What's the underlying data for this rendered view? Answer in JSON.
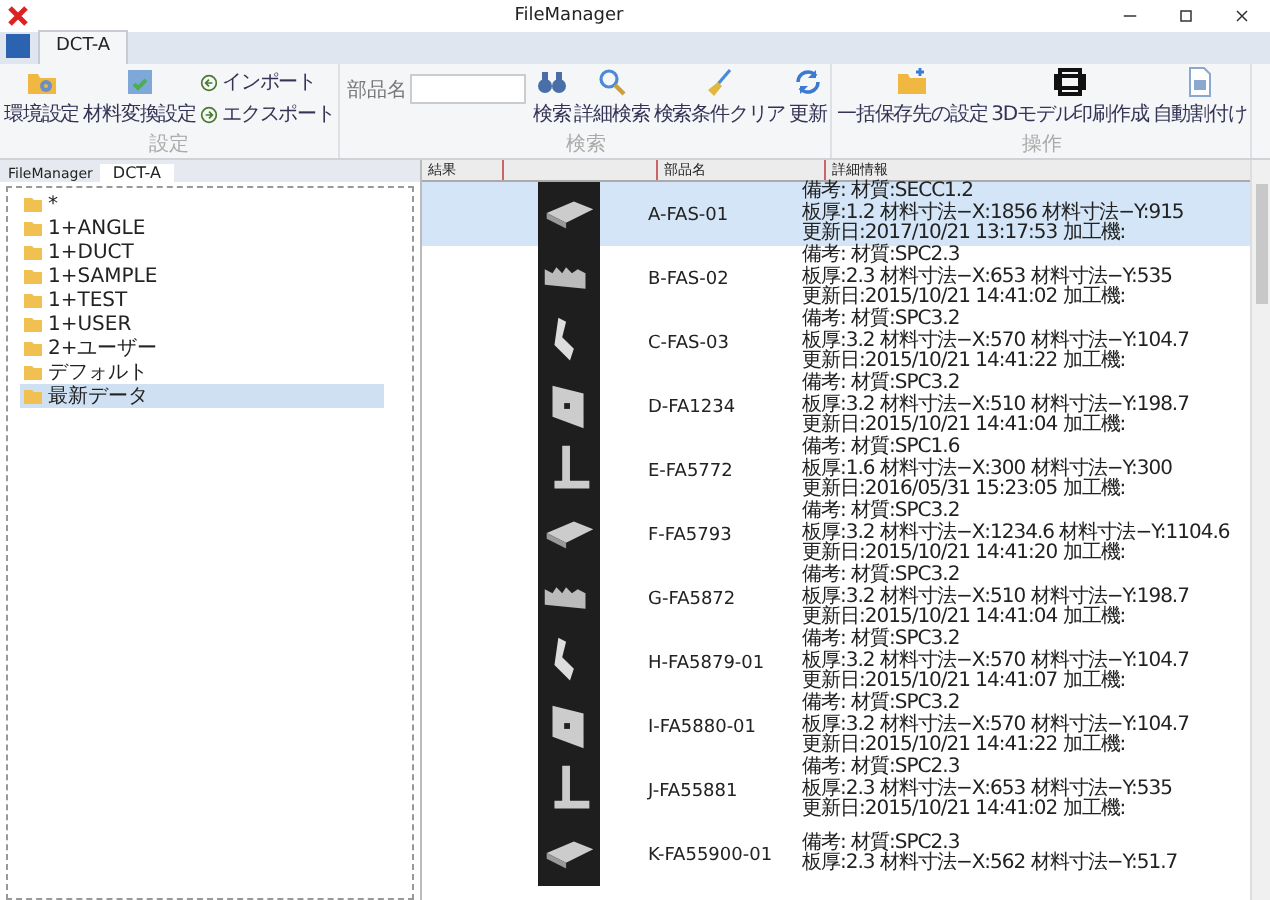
{
  "window": {
    "title": "FileManager"
  },
  "tabs": [
    {
      "label": "DCT-A",
      "selected": true
    }
  ],
  "ribbon": {
    "groups": [
      {
        "label": "設定",
        "items": [
          {
            "kind": "large",
            "label": "環境設定"
          },
          {
            "kind": "large",
            "label": "材料変換設定"
          },
          {
            "kind": "stack",
            "buttons": [
              "インポート",
              "エクスポート"
            ]
          }
        ]
      },
      {
        "label": "検索",
        "items": [
          {
            "kind": "field",
            "label": "部品名"
          },
          {
            "kind": "large",
            "label": "検索"
          },
          {
            "kind": "large",
            "label": "詳細検索"
          },
          {
            "kind": "large",
            "label": "検索条件クリア"
          },
          {
            "kind": "large",
            "label": "更新"
          }
        ]
      },
      {
        "label": "操作",
        "items": [
          {
            "kind": "large",
            "label": "一括保存先の設定"
          },
          {
            "kind": "large",
            "label": "3Dモデル印刷作成"
          },
          {
            "kind": "large",
            "label": "自動割付け"
          }
        ]
      }
    ]
  },
  "sidebar": {
    "caption": "FileManager",
    "tab": "DCT-A",
    "items": [
      {
        "label": "*",
        "selected": false
      },
      {
        "label": "1+ANGLE",
        "selected": false
      },
      {
        "label": "1+DUCT",
        "selected": false
      },
      {
        "label": "1+SAMPLE",
        "selected": false
      },
      {
        "label": "1+TEST",
        "selected": false
      },
      {
        "label": "1+USER",
        "selected": false
      },
      {
        "label": "2+ユーザー",
        "selected": false
      },
      {
        "label": "デフォルト",
        "selected": false
      },
      {
        "label": "最新データ",
        "selected": true
      }
    ]
  },
  "table": {
    "columns": {
      "result": "結果",
      "part_name": "部品名",
      "details": "詳細情報"
    },
    "rows": [
      {
        "part_name": "A-FAS-01",
        "selected": true,
        "details": [
          "備考: 材質:SECC1.2",
          "板厚:1.2 材料寸法−X:1856 材料寸法−Y:915",
          "更新日:2017/10/21 13:17:53 加工機:"
        ]
      },
      {
        "part_name": "B-FAS-02",
        "selected": false,
        "details": [
          "備考: 材質:SPC2.3",
          "板厚:2.3 材料寸法−X:653 材料寸法−Y:535",
          "更新日:2015/10/21 14:41:02 加工機:"
        ]
      },
      {
        "part_name": "C-FAS-03",
        "selected": false,
        "details": [
          "備考: 材質:SPC3.2",
          "板厚:3.2 材料寸法−X:570 材料寸法−Y:104.7",
          "更新日:2015/10/21 14:41:22 加工機:"
        ]
      },
      {
        "part_name": "D-FA1234",
        "selected": false,
        "details": [
          "備考: 材質:SPC3.2",
          "板厚:3.2 材料寸法−X:510 材料寸法−Y:198.7",
          "更新日:2015/10/21 14:41:04 加工機:"
        ]
      },
      {
        "part_name": "E-FA5772",
        "selected": false,
        "details": [
          "備考: 材質:SPC1.6",
          "板厚:1.6 材料寸法−X:300 材料寸法−Y:300",
          "更新日:2016/05/31 15:23:05 加工機:"
        ]
      },
      {
        "part_name": "F-FA5793",
        "selected": false,
        "details": [
          "備考: 材質:SPC3.2",
          "板厚:3.2 材料寸法−X:1234.6 材料寸法−Y:1104.6",
          "更新日:2015/10/21 14:41:20 加工機:"
        ]
      },
      {
        "part_name": "G-FA5872",
        "selected": false,
        "details": [
          "備考: 材質:SPC3.2",
          "板厚:3.2 材料寸法−X:510 材料寸法−Y:198.7",
          "更新日:2015/10/21 14:41:04 加工機:"
        ]
      },
      {
        "part_name": "H-FA5879-01",
        "selected": false,
        "details": [
          "備考: 材質:SPC3.2",
          "板厚:3.2 材料寸法−X:570 材料寸法−Y:104.7",
          "更新日:2015/10/21 14:41:07 加工機:"
        ]
      },
      {
        "part_name": "I-FA5880-01",
        "selected": false,
        "details": [
          "備考: 材質:SPC3.2",
          "板厚:3.2 材料寸法−X:570 材料寸法−Y:104.7",
          "更新日:2015/10/21 14:41:22 加工機:"
        ]
      },
      {
        "part_name": "J-FA55881",
        "selected": false,
        "details": [
          "備考: 材質:SPC2.3",
          "板厚:2.3 材料寸法−X:653 材料寸法−Y:535",
          "更新日:2015/10/21 14:41:02 加工機:"
        ]
      },
      {
        "part_name": "K-FA55900-01",
        "selected": false,
        "details": [
          "備考: 材質:SPC2.3",
          "板厚:2.3 材料寸法−X:562 材料寸法−Y:51.7"
        ]
      }
    ]
  }
}
